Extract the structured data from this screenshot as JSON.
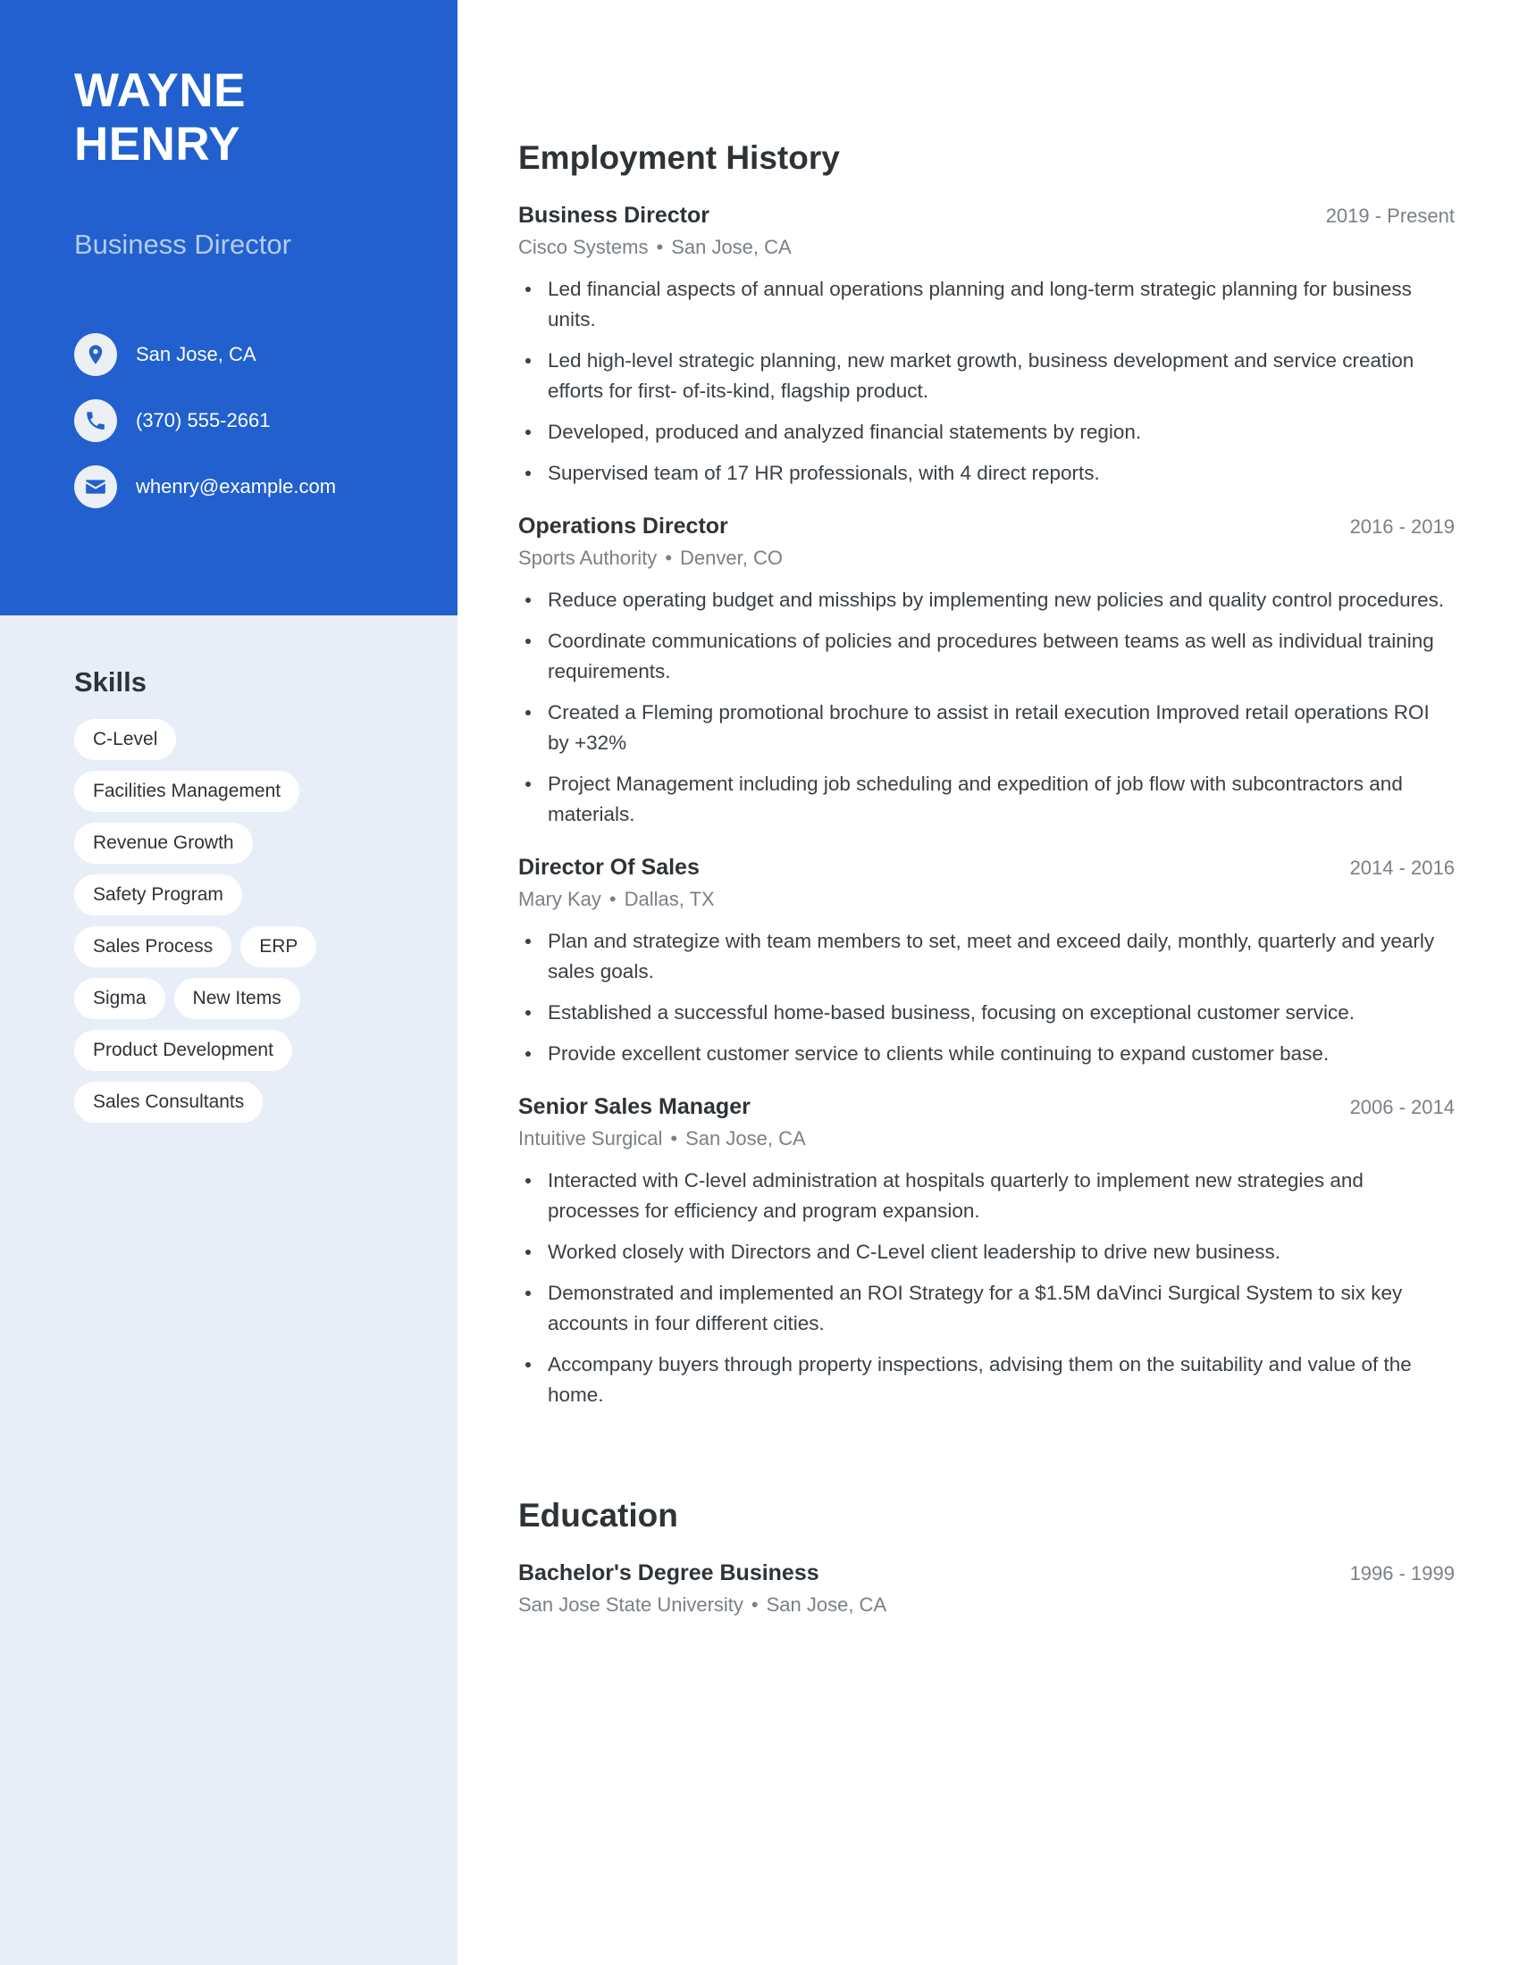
{
  "theme": {
    "accent_blue": "#2160ce",
    "sidebar_bg": "#e8eef8",
    "tag_bg": "#ffffff",
    "subtitle_color": "#b4cbee",
    "meta_color": "#7a8087",
    "text_color": "#2e3338"
  },
  "header": {
    "first_name": "WAYNE",
    "last_name": "HENRY",
    "job_title": "Business Director"
  },
  "contact": {
    "items": [
      {
        "icon": "location-pin-icon",
        "value": "San Jose, CA"
      },
      {
        "icon": "phone-icon",
        "value": "(370) 555-2661"
      },
      {
        "icon": "envelope-icon",
        "value": "whenry@example.com"
      }
    ]
  },
  "skills": {
    "heading": "Skills",
    "tags": [
      "C-Level",
      "Facilities Management",
      "Revenue Growth",
      "Safety Program",
      "Sales Process",
      "ERP",
      "Sigma",
      "New Items",
      "Product Development",
      "Sales Consultants"
    ]
  },
  "employment": {
    "heading": "Employment History",
    "entries": [
      {
        "title": "Business Director",
        "dates": "2019 - Present",
        "company": "Cisco Systems",
        "location": "San Jose, CA",
        "bullets": [
          "Led financial aspects of annual operations planning and long-term strategic planning for business units.",
          "Led high-level strategic planning, new market growth, business development and service creation efforts for first- of-its-kind, flagship product.",
          "Developed, produced and analyzed financial statements by region.",
          "Supervised team of 17 HR professionals, with 4 direct reports."
        ]
      },
      {
        "title": "Operations Director",
        "dates": "2016 - 2019",
        "company": "Sports Authority",
        "location": "Denver, CO",
        "bullets": [
          "Reduce operating budget and misships by implementing new policies and quality control procedures.",
          "Coordinate communications of policies and procedures between teams as well as individual training requirements.",
          "Created a Fleming promotional brochure to assist in retail execution Improved retail operations ROI by +32%",
          "Project Management including job scheduling and expedition of job flow with subcontractors and materials."
        ]
      },
      {
        "title": "Director Of Sales",
        "dates": "2014 - 2016",
        "company": "Mary Kay",
        "location": "Dallas, TX",
        "bullets": [
          "Plan and strategize with team members to set, meet and exceed daily, monthly, quarterly and yearly sales goals.",
          "Established a successful home-based business, focusing on exceptional customer service.",
          "Provide excellent customer service to clients while continuing to expand customer base."
        ]
      },
      {
        "title": "Senior Sales Manager",
        "dates": "2006 - 2014",
        "company": "Intuitive Surgical",
        "location": "San Jose, CA",
        "bullets": [
          "Interacted with C-level administration at hospitals quarterly to implement new strategies and processes for efficiency and program expansion.",
          "Worked closely with Directors and C-Level client leadership to drive new business.",
          "Demonstrated and implemented an ROI Strategy for a $1.5M daVinci Surgical System to six key accounts in four different cities.",
          "Accompany buyers through property inspections, advising them on the suitability and value of the home."
        ]
      }
    ]
  },
  "education": {
    "heading": "Education",
    "entries": [
      {
        "title": "Bachelor's Degree Business",
        "dates": "1996 - 1999",
        "school": "San Jose State University",
        "location": "San Jose, CA"
      }
    ]
  }
}
